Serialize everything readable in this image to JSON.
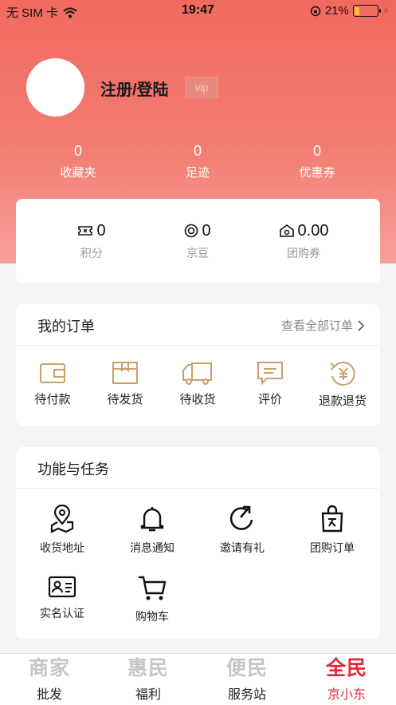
{
  "status_bar": {
    "carrier": "无 SIM 卡",
    "time": "19:47",
    "battery": "21%",
    "battery_level": 0.21
  },
  "profile": {
    "login_label": "注册/登陆",
    "vip_label": "vip"
  },
  "stats": [
    {
      "value": "0",
      "label": "收藏夹"
    },
    {
      "value": "0",
      "label": "足迹"
    },
    {
      "value": "0",
      "label": "优惠券"
    }
  ],
  "points": [
    {
      "icon": "ticket-icon",
      "value": "0",
      "label": "积分"
    },
    {
      "icon": "coin-icon",
      "value": "0",
      "label": "京豆"
    },
    {
      "icon": "group-coupon-icon",
      "value": "0.00",
      "label": "团购券"
    }
  ],
  "orders": {
    "title": "我的订单",
    "view_all": "查看全部订单",
    "items": [
      {
        "icon": "wallet-icon",
        "label": "待付款"
      },
      {
        "icon": "box-icon",
        "label": "待发货"
      },
      {
        "icon": "truck-icon",
        "label": "待收货"
      },
      {
        "icon": "comment-icon",
        "label": "评价"
      },
      {
        "icon": "refund-icon",
        "label": "退款退货"
      }
    ]
  },
  "tasks": {
    "title": "功能与任务",
    "items": [
      {
        "icon": "location-icon",
        "label": "收货地址"
      },
      {
        "icon": "bell-icon",
        "label": "消息通知"
      },
      {
        "icon": "invite-icon",
        "label": "邀请有礼"
      },
      {
        "icon": "shopping-bag-icon",
        "label": "团购订单"
      },
      {
        "icon": "id-card-icon",
        "label": "实名认证"
      },
      {
        "icon": "cart-icon",
        "label": "购物车"
      }
    ]
  },
  "tabbar": [
    {
      "big": "商家",
      "small": "批发"
    },
    {
      "big": "惠民",
      "small": "福利"
    },
    {
      "big": "便民",
      "small": "服务站"
    },
    {
      "big": "全民",
      "small": "京小东"
    }
  ],
  "colors": {
    "accent": "#e4283a",
    "hero": "#f26a5e",
    "icon_gold": "#c9a06a"
  }
}
